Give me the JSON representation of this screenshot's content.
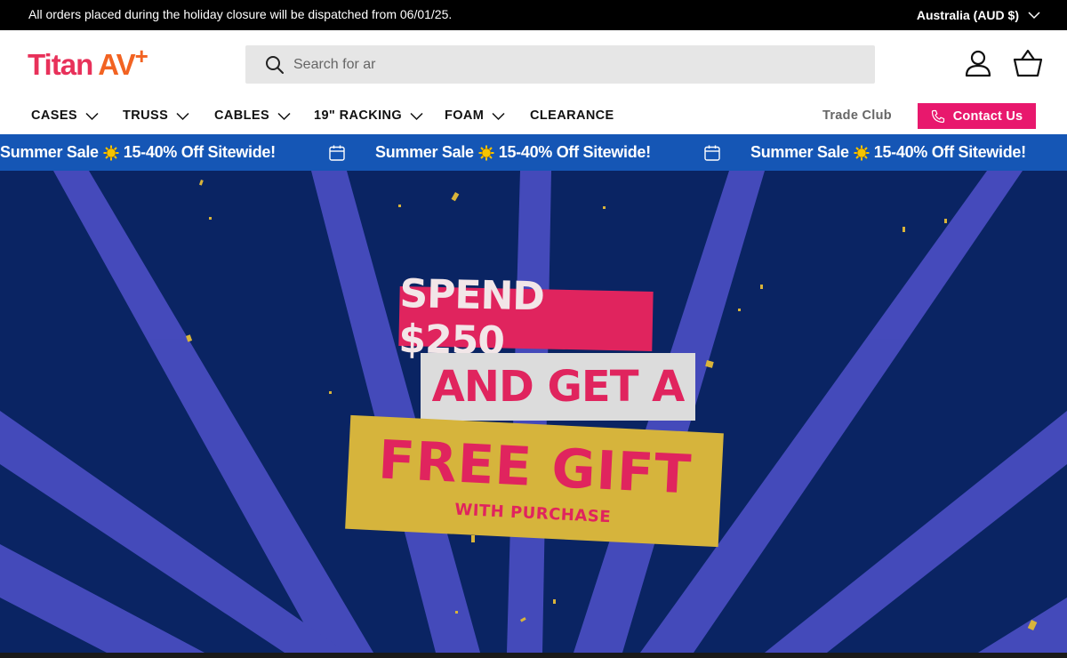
{
  "announcement": {
    "text": "All orders placed during the holiday closure will be dispatched from 06/01/25.",
    "country": "Australia (AUD $)"
  },
  "header": {
    "logo_titan": "Titan",
    "logo_av": "AV",
    "logo_plus": "+",
    "search_placeholder": "Search for ar"
  },
  "nav": {
    "items": [
      {
        "label": "CASES",
        "has_dropdown": true
      },
      {
        "label": "TRUSS",
        "has_dropdown": true
      },
      {
        "label": "CABLES",
        "has_dropdown": true
      },
      {
        "label": "19\" RACKING",
        "has_dropdown": true
      },
      {
        "label": "FOAM",
        "has_dropdown": true
      },
      {
        "label": "CLEARANCE",
        "has_dropdown": false
      }
    ],
    "trade_club": "Trade Club",
    "contact": "Contact Us"
  },
  "marquee": {
    "items": [
      {
        "left": "Summer Sale",
        "right": "15-40% Off Sitewide!"
      },
      {
        "left": "Summer Sale",
        "right": "15-40% Off Sitewide!"
      },
      {
        "left": "Summer Sale",
        "right": "15-40% Off Sitewide!"
      }
    ]
  },
  "hero": {
    "line1": "SPEND $250",
    "line2": "AND GET A",
    "line3": "FREE GIFT",
    "line4": "WITH PURCHASE"
  },
  "colors": {
    "brand_pink": "#e8186d",
    "brand_orange": "#f26322",
    "marquee_blue": "#1556b5",
    "hero_navy": "#0a2463",
    "hero_rays": "#4b4fc4",
    "gift_yellow": "#d6b43c"
  },
  "icons": [
    "chevron-down-icon",
    "search-icon",
    "account-icon",
    "cart-icon",
    "phone-icon",
    "calendar-icon",
    "sun-icon"
  ]
}
